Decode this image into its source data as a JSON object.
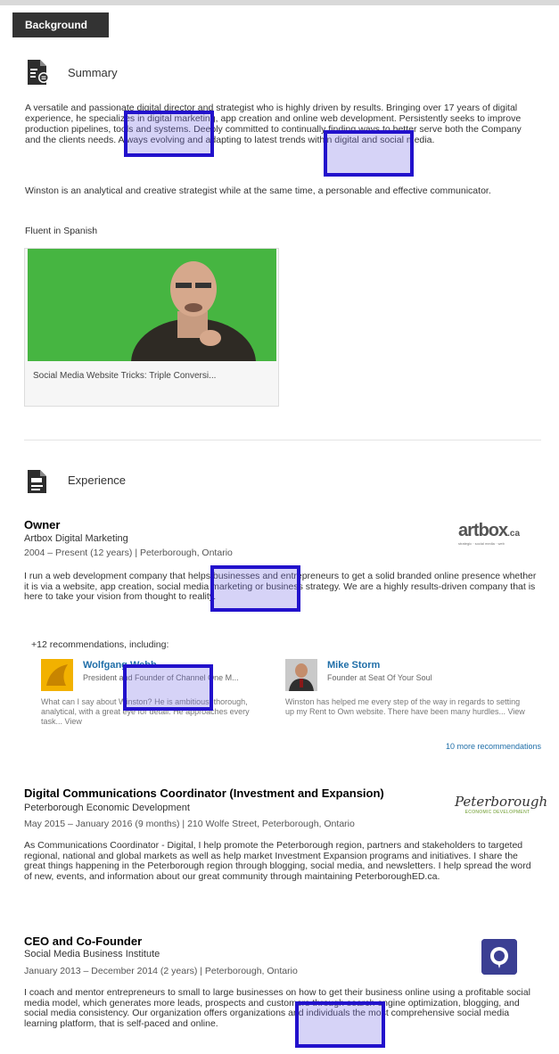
{
  "tab": {
    "label": "Background"
  },
  "summary": {
    "title": "Summary",
    "paragraph1": "A versatile and passionate digital director and strategist who is highly driven by results. Bringing over 17 years of digital experience, he specializes in digital marketing, app creation and online web development. Persistently seeks to improve production pipelines, tools and systems. Deeply committed to continually finding ways to better serve both the Company and the clients needs. Always evolving and adapting to latest trends within digital and social media.",
    "paragraph2": "Winston is an analytical and creative strategist while at the same time, a personable and effective communicator.",
    "paragraph3": "Fluent in Spanish",
    "video_caption": "Social Media Website Tricks: Triple Conversi..."
  },
  "experience": {
    "title": "Experience",
    "jobs": [
      {
        "title": "Owner",
        "company": "Artbox Digital Marketing",
        "meta": "2004 – Present (12 years)  |  Peterborough, Ontario",
        "description": "I run a web development company that helps businesses and entrepreneurs to get a solid branded online presence whether it is via a website, app creation, social media marketing or business strategy. We are a highly results-driven company that is here to take your vision from thought to reality.",
        "logo_text": "artbox",
        "logo_suffix": ".ca",
        "logo_tagline": "strategic · social media · web"
      },
      {
        "title": "Digital Communications Coordinator (Investment and Expansion)",
        "company": "Peterborough Economic Development",
        "meta": "May 2015 – January 2016 (9 months)  |  210 Wolfe Street, Peterborough, Ontario",
        "description": "As Communications Coordinator - Digital, I help promote the Peterborough region, partners and stakeholders to targeted regional, national and global markets as well as help market Investment Expansion programs and initiatives. I share the great things happening in the Peterborough region through blogging, social media, and newsletters. I help spread the word of new, events, and information about our great community through maintaining PeterboroughED.ca.",
        "logo_text": "Peterborough",
        "logo_tagline": "ECONOMIC DEVELOPMENT"
      },
      {
        "title": "CEO and Co-Founder",
        "company": "Social Media Business Institute",
        "meta": "January 2013 – December 2014 (2 years)  |  Peterborough, Ontario",
        "description": "I coach and mentor entrepreneurs to small to large businesses on how to get their business online using a profitable social media model, which generates more leads, prospects and customers through search engine optimization, blogging, and social media consistency. Our organization offers organizations and individuals the most comprehensive social media learning platform, that is self-paced and online."
      }
    ]
  },
  "recommendations": {
    "header": "+12 recommendations, including:",
    "items": [
      {
        "name": "Wolfgang Webb",
        "role": "President and Founder of Channel One M...",
        "text": "What can I say about Winston? He is ambitious, thorough, analytical, with a great eye for detail. He approaches every task... View"
      },
      {
        "name": "Mike Storm",
        "role": "Founder at Seat Of Your Soul",
        "text": "Winston has helped me every step of the way in regards to setting up my Rent to Own website. There have been many hurdles... View"
      }
    ],
    "more_link": "10 more recommendations"
  },
  "colors": {
    "highlight_border": "#2211cc",
    "link": "#1f6ea8",
    "tab_bg": "#333333"
  }
}
